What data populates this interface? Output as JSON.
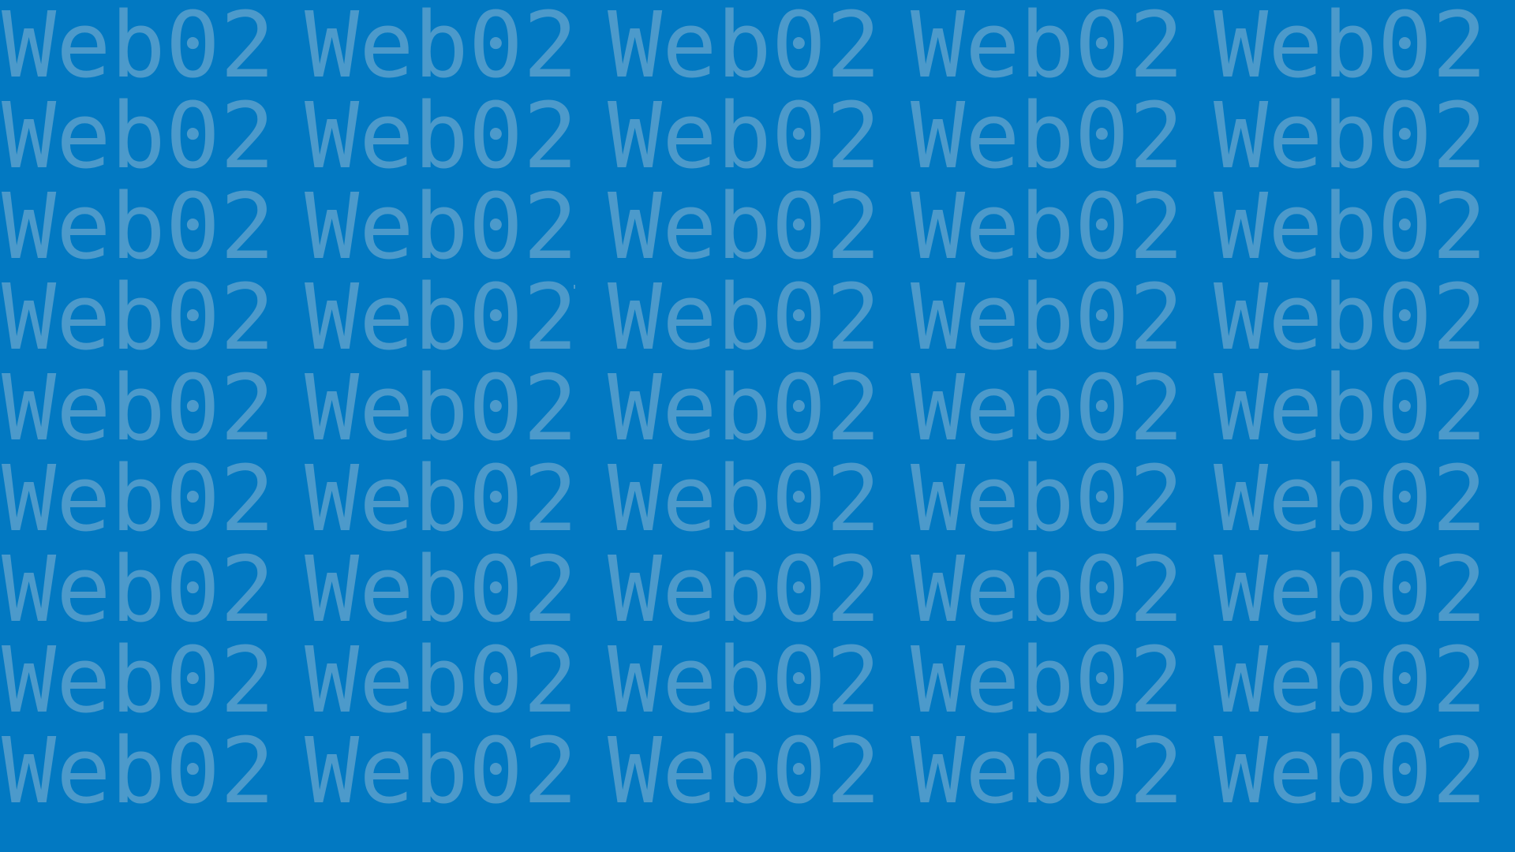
{
  "desktop": {
    "background_color": "#0279C2",
    "watermark_color": "#4C9ACB",
    "watermark": {
      "rows": [
        [
          "Web02",
          "Web02",
          "Web02",
          "Web02",
          "Web02"
        ],
        [
          "Web02",
          "Web02",
          "Web02",
          "Web02",
          "Web02"
        ],
        [
          "Web02",
          "Web02",
          "Web02",
          "Web02",
          "Web02"
        ],
        [
          "Web02",
          "Web02",
          "Web02",
          "Web02",
          "Web02"
        ],
        [
          "Web02",
          "Web02",
          "Web02",
          "Web02",
          "Web02"
        ],
        [
          "Web02",
          "Web02",
          "Web02",
          "Web02",
          "Web02"
        ],
        [
          "Web02",
          "Web02",
          "Web02",
          "Web02",
          "Web02"
        ],
        [
          "Web02",
          "Web02",
          "Web02",
          "Web02",
          "Web02"
        ],
        [
          "Web02",
          "Web02",
          "Web02",
          "Web02",
          "Web02"
        ]
      ]
    }
  }
}
